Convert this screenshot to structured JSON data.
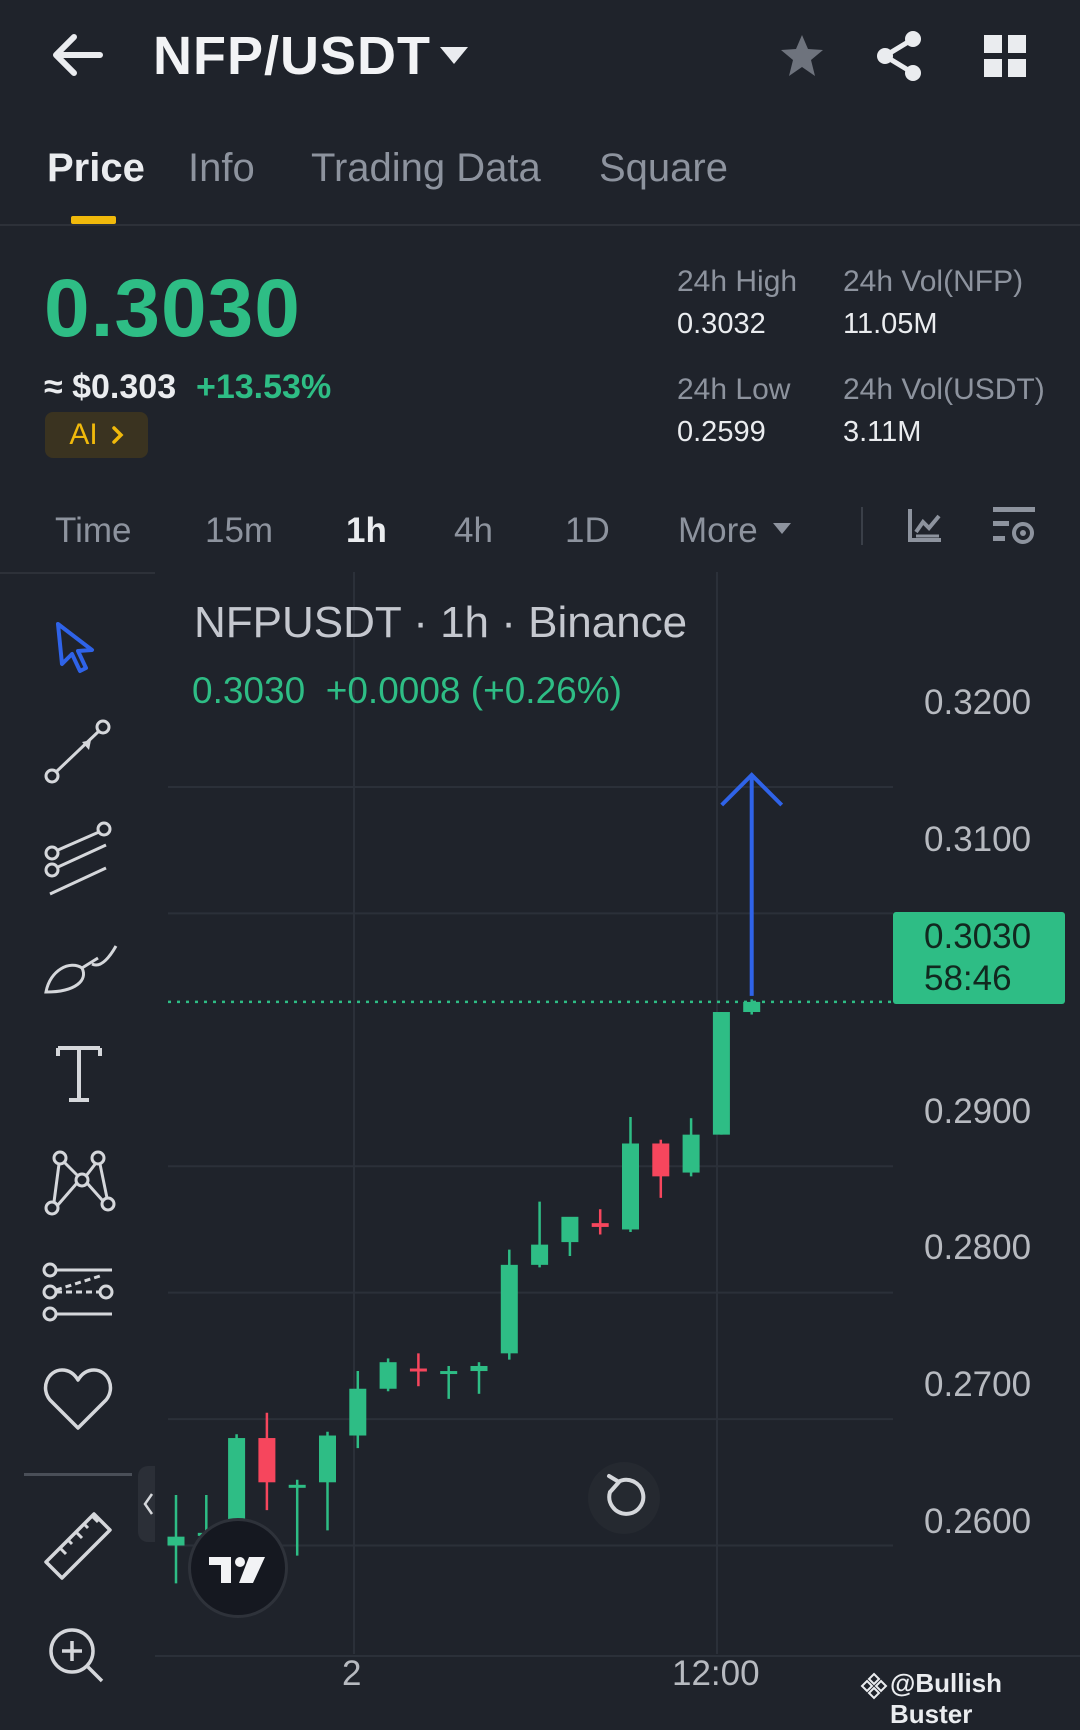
{
  "header": {
    "pair": "NFP/USDT"
  },
  "tabs": [
    {
      "label": "Price"
    },
    {
      "label": "Info"
    },
    {
      "label": "Trading Data"
    },
    {
      "label": "Square"
    }
  ],
  "price": {
    "last": "0.3030",
    "usd": "≈ $0.303",
    "change_pct": "+13.53%",
    "ai_label": "AI",
    "stats": {
      "high_label": "24h High",
      "high": "0.3032",
      "low_label": "24h Low",
      "low": "0.2599",
      "vol_base_label": "24h Vol(NFP)",
      "vol_base": "11.05M",
      "vol_quote_label": "24h Vol(USDT)",
      "vol_quote": "3.11M"
    }
  },
  "timeframes": [
    {
      "label": "Time"
    },
    {
      "label": "15m"
    },
    {
      "label": "1h"
    },
    {
      "label": "4h"
    },
    {
      "label": "1D"
    },
    {
      "label": "More"
    }
  ],
  "chart": {
    "title": "NFPUSDT · 1h · Binance",
    "quote": "0.3030  +0.0008 (+0.26%)",
    "last_price": "0.3030",
    "countdown": "58:46",
    "y_labels": [
      "0.3200",
      "0.3100",
      "0.2900",
      "0.2800",
      "0.2700",
      "0.2600"
    ],
    "x_labels": [
      "2",
      "12:00"
    ]
  },
  "chart_data": {
    "type": "candlestick",
    "title": "NFPUSDT · 1h · Binance",
    "ylim": [
      0.253,
      0.334
    ],
    "y_ticks": [
      0.32,
      0.31,
      0.29,
      0.28,
      0.27,
      0.26
    ],
    "candles": [
      {
        "o": 0.26,
        "h": 0.264,
        "l": 0.257,
        "c": 0.2607
      },
      {
        "o": 0.261,
        "h": 0.264,
        "l": 0.2562,
        "c": 0.261
      },
      {
        "o": 0.2612,
        "h": 0.2688,
        "l": 0.2604,
        "c": 0.2685
      },
      {
        "o": 0.2685,
        "h": 0.2705,
        "l": 0.2628,
        "c": 0.265
      },
      {
        "o": 0.2648,
        "h": 0.2652,
        "l": 0.2592,
        "c": 0.2648
      },
      {
        "o": 0.265,
        "h": 0.269,
        "l": 0.2612,
        "c": 0.2687
      },
      {
        "o": 0.2687,
        "h": 0.2738,
        "l": 0.2677,
        "c": 0.2724
      },
      {
        "o": 0.2724,
        "h": 0.2748,
        "l": 0.2722,
        "c": 0.2745
      },
      {
        "o": 0.274,
        "h": 0.2752,
        "l": 0.2726,
        "c": 0.2738
      },
      {
        "o": 0.2738,
        "h": 0.2742,
        "l": 0.2716,
        "c": 0.2738
      },
      {
        "o": 0.2738,
        "h": 0.2745,
        "l": 0.272,
        "c": 0.2742
      },
      {
        "o": 0.2752,
        "h": 0.2834,
        "l": 0.2747,
        "c": 0.2822
      },
      {
        "o": 0.2822,
        "h": 0.2872,
        "l": 0.282,
        "c": 0.2838
      },
      {
        "o": 0.284,
        "h": 0.2859,
        "l": 0.2829,
        "c": 0.286
      },
      {
        "o": 0.2855,
        "h": 0.2866,
        "l": 0.2846,
        "c": 0.2852
      },
      {
        "o": 0.285,
        "h": 0.2939,
        "l": 0.2848,
        "c": 0.2918
      },
      {
        "o": 0.2918,
        "h": 0.2921,
        "l": 0.2875,
        "c": 0.2892
      },
      {
        "o": 0.2895,
        "h": 0.2938,
        "l": 0.2892,
        "c": 0.2925
      },
      {
        "o": 0.2925,
        "h": 0.3022,
        "l": 0.2925,
        "c": 0.3022
      },
      {
        "o": 0.3022,
        "h": 0.3032,
        "l": 0.302,
        "c": 0.303
      }
    ]
  },
  "watermark": "@Bullish Buster",
  "colors": {
    "up": "#2ebd85",
    "down": "#f6465d",
    "accent": "#f0b90b",
    "arrow": "#2f63e8",
    "bg": "#1f232b"
  }
}
